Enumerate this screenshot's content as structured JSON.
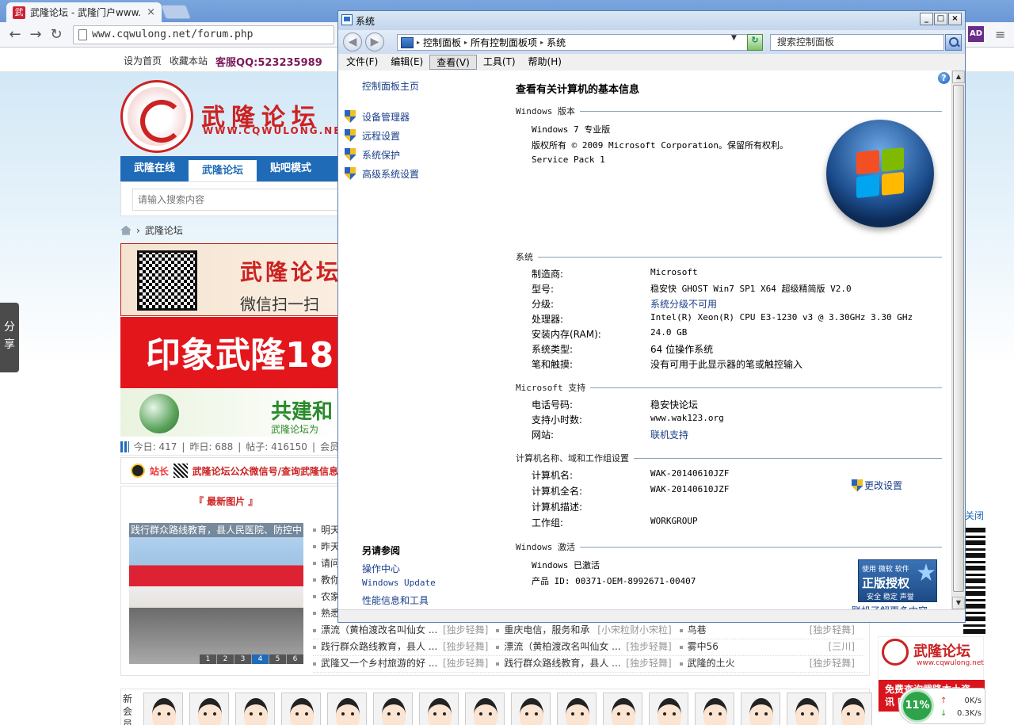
{
  "browser": {
    "tab_title": "武隆论坛 - 武隆门户www.",
    "tab_favicon": "武",
    "tab_close": "×",
    "url": "www.cqwulong.net/forum.php",
    "back_glyph": "←",
    "forward_glyph": "→",
    "reload_glyph": "↻",
    "extension_label": "AD",
    "menu_glyph": "≡"
  },
  "forum": {
    "top_links": [
      "设为首页",
      "收藏本站"
    ],
    "qq_label": "客服QQ:523235989",
    "logo_title": "武隆论坛",
    "logo_url": "WWW.CQWULONG.NET",
    "nav_tabs": [
      {
        "label": "武隆在线",
        "active": false
      },
      {
        "label": "武隆论坛",
        "active": true
      },
      {
        "label": "贴吧模式",
        "active": false
      }
    ],
    "search_placeholder": "请输入搜索内容",
    "breadcrumb": {
      "separator": "›",
      "current": "武隆论坛"
    },
    "banner1_title": "武隆论坛",
    "banner1_sub": "微信扫一扫",
    "banner2_text": "印象武隆18",
    "banner3_title": "共建和",
    "banner3_sub": "武隆论坛为",
    "stats": {
      "today": "今日: 417",
      "yesterday": "昨日: 688",
      "posts": "帖子: 416150",
      "members": "会员"
    },
    "notice": {
      "label": "站长",
      "link": "武隆论坛公众微信号/查询武隆信息"
    },
    "new_pics_title": "『 最新图片 』",
    "photo_caption": "践行群众路线教育，县人民医院、防控中",
    "photo_dots": [
      "1",
      "2",
      "3",
      "4",
      "5",
      "6"
    ],
    "side_list": [
      "明天",
      "昨天",
      "请问",
      "教你",
      "农家",
      "熟悉"
    ],
    "grid_rows": [
      [
        {
          "title": "漂流（黄柏渡改名叫仙女 ...",
          "author": "[独步轻舞]"
        },
        {
          "title": "重庆电信，服务和承",
          "author": "[小宋粒财小宋粒]"
        },
        {
          "title": "鸟巷",
          "author": "[独步轻舞]"
        }
      ],
      [
        {
          "title": "践行群众路线教育，县人 ...",
          "author": "[独步轻舞]"
        },
        {
          "title": "漂流（黄柏渡改名叫仙女 ...",
          "author": "[独步轻舞]"
        },
        {
          "title": "雾中56",
          "author": "[三川]"
        }
      ],
      [
        {
          "title": "武隆又一个乡村旅游的好 ...",
          "author": "[独步轻舞]"
        },
        {
          "title": "践行群众路线教育，县人 ...",
          "author": "[独步轻舞]"
        },
        {
          "title": "武隆的土火",
          "author": "[独步轻舞]"
        }
      ]
    ],
    "members_label": "新会员",
    "share_label": "分享",
    "right_ad_close": "关闭",
    "adbox": {
      "title": "武隆论坛",
      "url": "www.cqwulong.net",
      "band": "免费查询武隆本土资讯 吃住"
    }
  },
  "netmon": {
    "percent": "11%",
    "up": "0K/s",
    "down": "0.3K/s"
  },
  "window": {
    "title": "系统",
    "buttons": {
      "minimize": "_",
      "maximize": "□",
      "close": "×"
    },
    "back_glyph": "◀",
    "forward_glyph": "▶",
    "address_path": [
      "控制面板",
      "所有控制面板项",
      "系统"
    ],
    "address_sep": "▸",
    "address_dropdown": "▼",
    "refresh_glyph": "↻",
    "search_placeholder": "搜索控制面板",
    "menu": [
      {
        "label": "文件(F)",
        "active": false
      },
      {
        "label": "编辑(E)",
        "active": false
      },
      {
        "label": "查看(V)",
        "active": true
      },
      {
        "label": "工具(T)",
        "active": false
      },
      {
        "label": "帮助(H)",
        "active": false
      }
    ],
    "left_home": "控制面板主页",
    "left_links": [
      "设备管理器",
      "远程设置",
      "系统保护",
      "高级系统设置"
    ],
    "see_also": {
      "heading": "另请参阅",
      "links": [
        "操作中心",
        "Windows Update",
        "性能信息和工具"
      ]
    },
    "main_title": "查看有关计算机的基本信息",
    "edition": {
      "heading": "Windows 版本",
      "name": "Windows 7 专业版",
      "copyright": "版权所有 © 2009 Microsoft Corporation。保留所有权利。",
      "service_pack": "Service Pack 1"
    },
    "system": {
      "heading": "系统",
      "rows": [
        {
          "k": "制造商:",
          "v": "Microsoft"
        },
        {
          "k": "型号:",
          "v": "稳安快 GHOST Win7 SP1 X64 超级精简版 V2.0"
        },
        {
          "k": "分级:",
          "v": "系统分级不可用"
        },
        {
          "k": "处理器:",
          "v": "Intel(R) Xeon(R) CPU E3-1230 v3 @ 3.30GHz   3.30 GHz"
        },
        {
          "k": "安装内存(RAM):",
          "v": "24.0 GB"
        },
        {
          "k": "系统类型:",
          "v": "64 位操作系统"
        },
        {
          "k": "笔和触摸:",
          "v": "没有可用于此显示器的笔或触控输入"
        }
      ]
    },
    "support": {
      "heading": "Microsoft 支持",
      "rows": [
        {
          "k": "电话号码:",
          "v": "稳安快论坛"
        },
        {
          "k": "支持小时数:",
          "v": "www.wak123.org"
        },
        {
          "k": "网站:",
          "v": "联机支持"
        }
      ]
    },
    "computer": {
      "heading": "计算机名称、域和工作组设置",
      "change_label": "更改设置",
      "rows": [
        {
          "k": "计算机名:",
          "v": "WAK-20140610JZF"
        },
        {
          "k": "计算机全名:",
          "v": "WAK-20140610JZF"
        },
        {
          "k": "计算机描述:",
          "v": ""
        },
        {
          "k": "工作组:",
          "v": "WORKGROUP"
        }
      ]
    },
    "activation": {
      "heading": "Windows 激活",
      "status": "Windows 已激活",
      "product_id": "产品 ID: 00371-OEM-8992671-00407",
      "genuine_line1": "使用 微软 软件",
      "genuine_line2": "正版授权",
      "genuine_line3": "安全 稳定 声誉",
      "more_link": "联机了解更多内容"
    },
    "help_glyph": "?",
    "scroll_up": "▲",
    "scroll_down": "▼"
  }
}
